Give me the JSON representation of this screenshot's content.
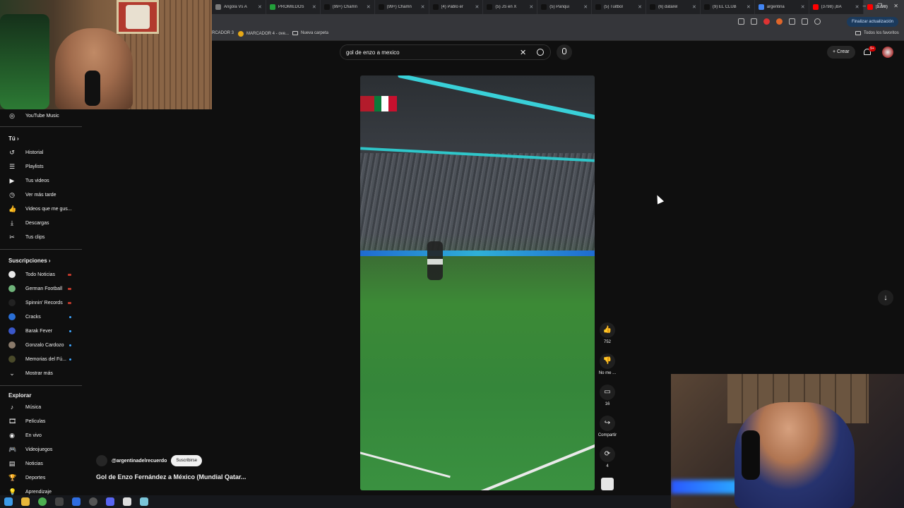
{
  "browser": {
    "tabs": [
      {
        "label": "Angola Vs A",
        "color": "#7a7a7a"
      },
      {
        "label": "PROMIEDOS",
        "color": "#22a03a"
      },
      {
        "label": "(99+) Chamn",
        "color": "#111111"
      },
      {
        "label": "(99+) Chamn",
        "color": "#111111"
      },
      {
        "label": "(4) Pablo er",
        "color": "#111111"
      },
      {
        "label": "(5) JS en X",
        "color": "#111111"
      },
      {
        "label": "(5) Panqui",
        "color": "#111111"
      },
      {
        "label": "(5) Tuitbol",
        "color": "#111111"
      },
      {
        "label": "(6) datarel",
        "color": "#111111"
      },
      {
        "label": "(9) EL CLUB",
        "color": "#111111"
      },
      {
        "label": "argentina",
        "color": "#4285f4"
      },
      {
        "label": "(3798) ¡BA",
        "color": "#ff0000"
      },
      {
        "label": "(3798)",
        "color": "#ff0000"
      }
    ],
    "update_label": "Finalizar actualización",
    "bookmarks": [
      "RCADOR 3",
      "MARCADOR 4 - ove...",
      "Nueva carpeta"
    ],
    "all_favorites": "Todos los favoritos"
  },
  "search": {
    "query": "gol de enzo a mexico"
  },
  "header": {
    "create_label": "Crear",
    "notif_count": "9+"
  },
  "sidebar": {
    "music": "YouTube Music",
    "you_heading": "Tú",
    "you_items": [
      {
        "label": "Historial",
        "icon": "history-icon",
        "glyph": "↺"
      },
      {
        "label": "Playlists",
        "icon": "playlist-icon",
        "glyph": "☰"
      },
      {
        "label": "Tus videos",
        "icon": "video-icon",
        "glyph": "▶"
      },
      {
        "label": "Ver más tarde",
        "icon": "clock-icon",
        "glyph": "◷"
      },
      {
        "label": "Videos que me gus...",
        "icon": "thumb-up-icon",
        "glyph": "👍"
      },
      {
        "label": "Descargas",
        "icon": "download-icon",
        "glyph": "⤓"
      },
      {
        "label": "Tus clips",
        "icon": "scissors-icon",
        "glyph": "✂"
      }
    ],
    "subs_heading": "Suscripciones",
    "subscriptions": [
      {
        "label": "Todo Noticias",
        "color": "#e8e8e8",
        "mark": "red"
      },
      {
        "label": "German Football",
        "color": "#6fb37a",
        "mark": "red"
      },
      {
        "label": "Spinnin' Records",
        "color": "#222222",
        "mark": "red"
      },
      {
        "label": "Cracks",
        "color": "#2a6fd6",
        "mark": "blue"
      },
      {
        "label": "Barak Fever",
        "color": "#3a57c9",
        "mark": "blue"
      },
      {
        "label": "Gonzalo Cardozo",
        "color": "#8a7a6a",
        "mark": "blue"
      },
      {
        "label": "Memorias del Fú...",
        "color": "#4a4a2a",
        "mark": "blue"
      }
    ],
    "show_more": "Mostrar más",
    "explore_heading": "Explorar",
    "explore_items": [
      {
        "label": "Música",
        "glyph": "♪",
        "icon": "music-icon"
      },
      {
        "label": "Películas",
        "glyph": "🎞",
        "icon": "film-icon"
      },
      {
        "label": "En vivo",
        "glyph": "◉",
        "icon": "live-icon"
      },
      {
        "label": "Videojuegos",
        "glyph": "🎮",
        "icon": "gamepad-icon"
      },
      {
        "label": "Noticias",
        "glyph": "▤",
        "icon": "news-icon"
      },
      {
        "label": "Deportes",
        "glyph": "🏆",
        "icon": "trophy-icon"
      },
      {
        "label": "Aprendizaje",
        "glyph": "💡",
        "icon": "bulb-icon"
      }
    ]
  },
  "short": {
    "channel": "@argentinadelrecuerdo",
    "subscribe_label": "Suscribirse",
    "title": "Gol de Enzo Fernández a México (Mundial Qatar..."
  },
  "actions": {
    "likes": "752",
    "dislike_label": "No me ...",
    "comments": "16",
    "share_label": "Compartir",
    "remix_count": "4"
  }
}
